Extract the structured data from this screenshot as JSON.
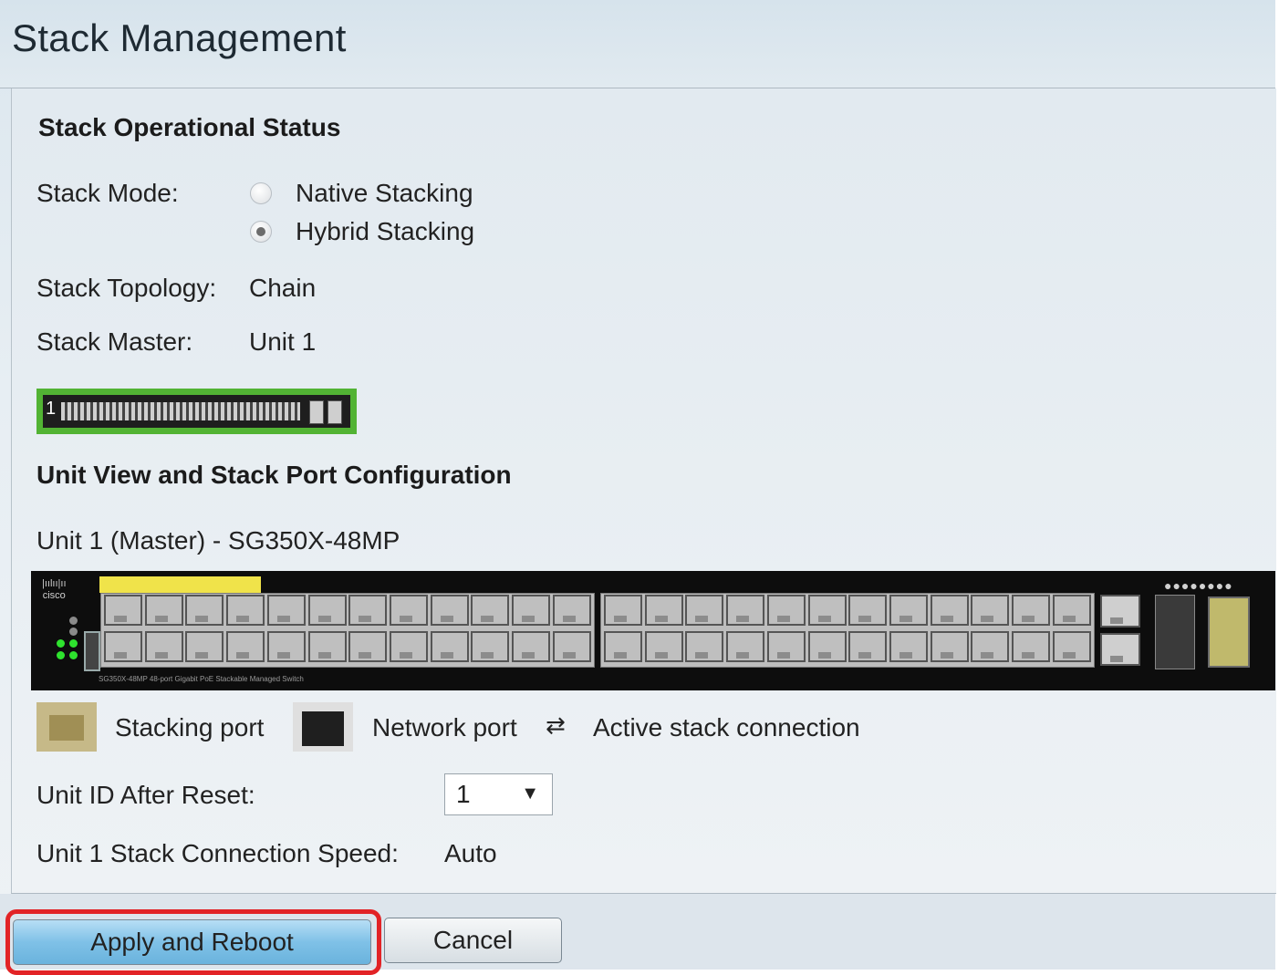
{
  "page": {
    "title": "Stack Management"
  },
  "status": {
    "section_title": "Stack Operational Status",
    "mode_label": "Stack Mode:",
    "mode_options": [
      {
        "label": "Native Stacking",
        "checked": false
      },
      {
        "label": "Hybrid Stacking",
        "checked": true
      }
    ],
    "topology_label": "Stack Topology:",
    "topology_value": "Chain",
    "master_label": "Stack Master:",
    "master_value": "Unit 1",
    "mini_unit_number": "1"
  },
  "unit_view": {
    "section_title": "Unit View and Stack Port Configuration",
    "unit_heading": "Unit 1 (Master) - SG350X-48MP",
    "switch_logo": "cisco",
    "switch_model_text": "SG350X-48MP   48-port Gigabit PoE Stackable Managed Switch"
  },
  "legend": {
    "stacking_port": "Stacking port",
    "network_port": "Network port",
    "active_connection": "Active stack connection"
  },
  "form": {
    "unit_id_label": "Unit ID After Reset:",
    "unit_id_value": "1",
    "speed_label": "Unit 1 Stack Connection Speed:",
    "speed_value": "Auto"
  },
  "buttons": {
    "apply": "Apply and Reboot",
    "cancel": "Cancel"
  },
  "colors": {
    "accent_highlight": "#e22326",
    "unit_selected": "#52b334",
    "stack_port": "#c6b988"
  }
}
